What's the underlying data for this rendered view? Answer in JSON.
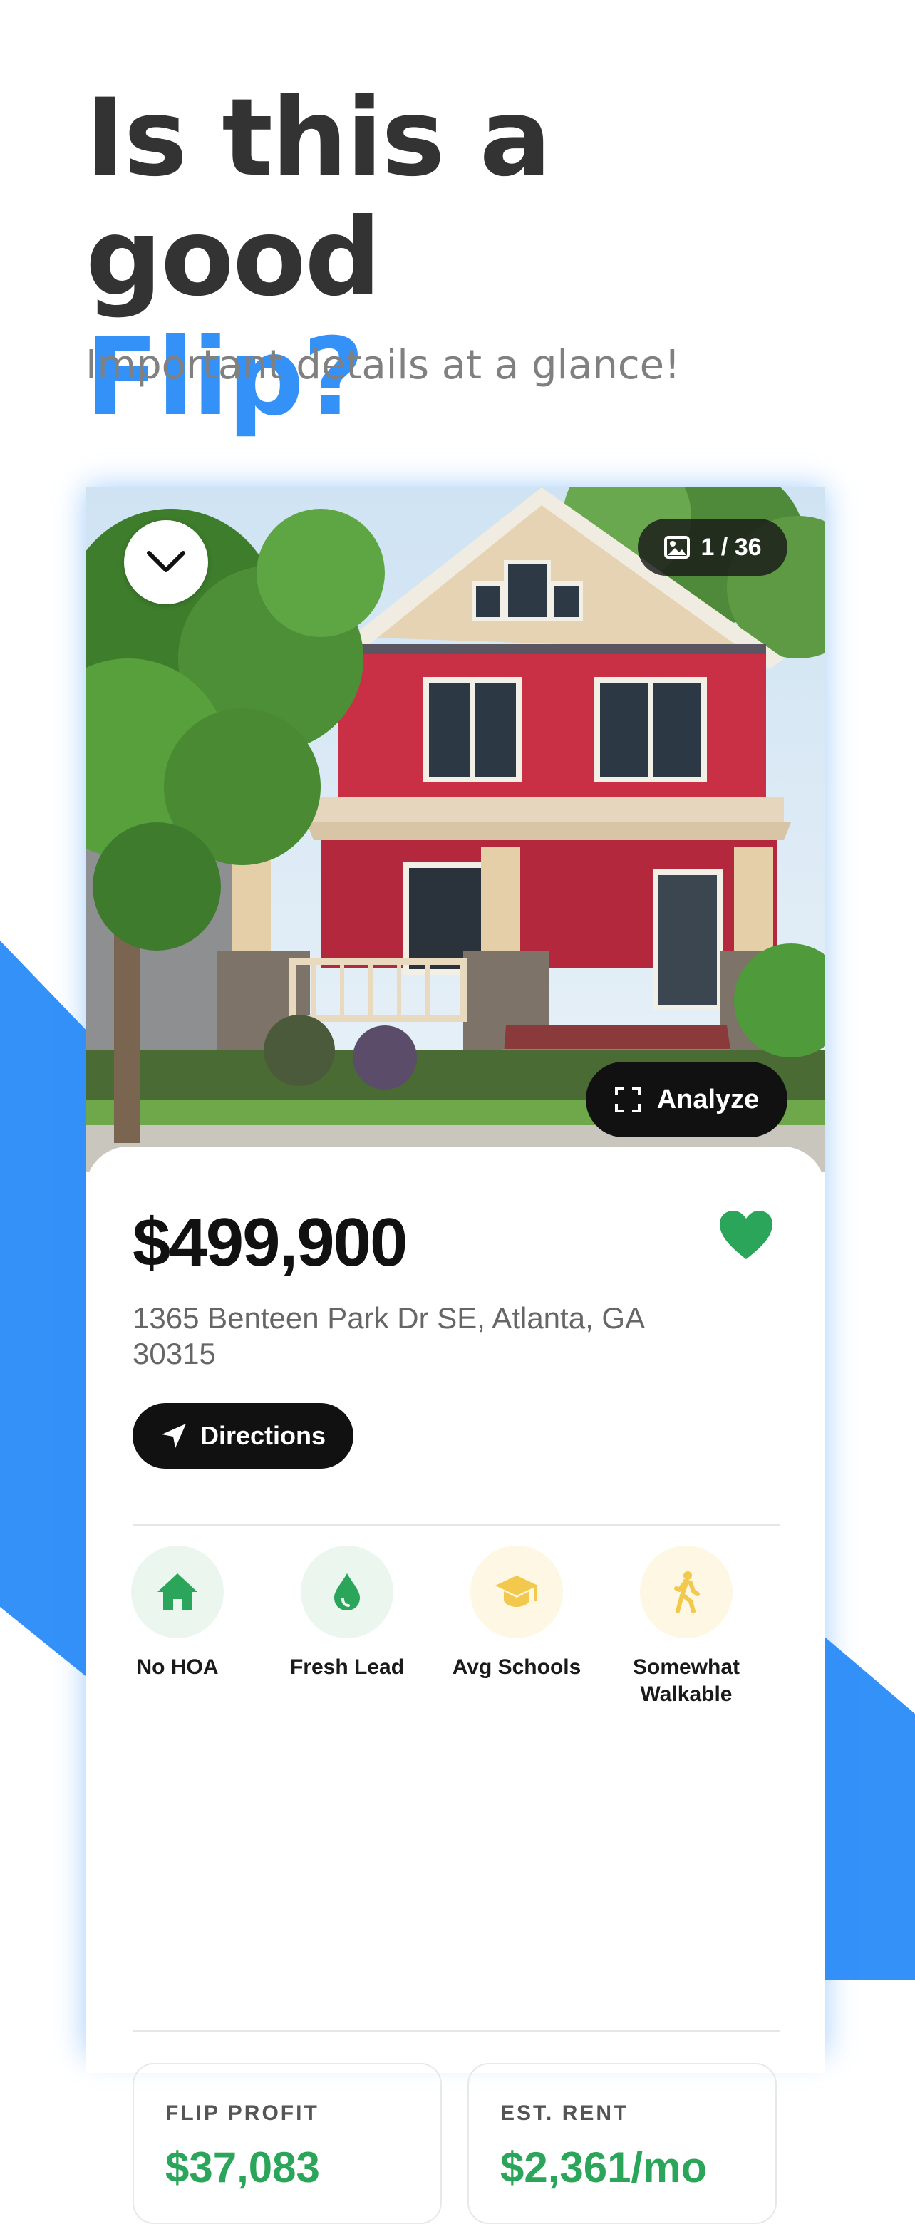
{
  "headline": {
    "line1": "Is this a good",
    "line2": "Flip?"
  },
  "subhead": "Important details at a glance!",
  "photo": {
    "counter": "1 / 36",
    "analyze_label": "Analyze"
  },
  "listing": {
    "price": "$499,900",
    "address": "1365 Benteen Park Dr SE, Atlanta, GA 30315",
    "directions_label": "Directions",
    "favorited": true
  },
  "features": [
    {
      "label": "No HOA",
      "icon": "home-icon"
    },
    {
      "label": "Fresh Lead",
      "icon": "drop-icon"
    },
    {
      "label": "Avg Schools",
      "icon": "graduation-cap-icon"
    },
    {
      "label": "Somewhat Walkable",
      "icon": "walking-person-icon"
    }
  ],
  "metrics": {
    "flip_profit": {
      "label": "FLIP PROFIT",
      "value": "$37,083"
    },
    "est_rent": {
      "label": "EST. RENT",
      "value": "$2,361/mo"
    }
  },
  "colors": {
    "accent": "#3391f8",
    "green": "#2aa55a",
    "yellow": "#f2c94c"
  }
}
